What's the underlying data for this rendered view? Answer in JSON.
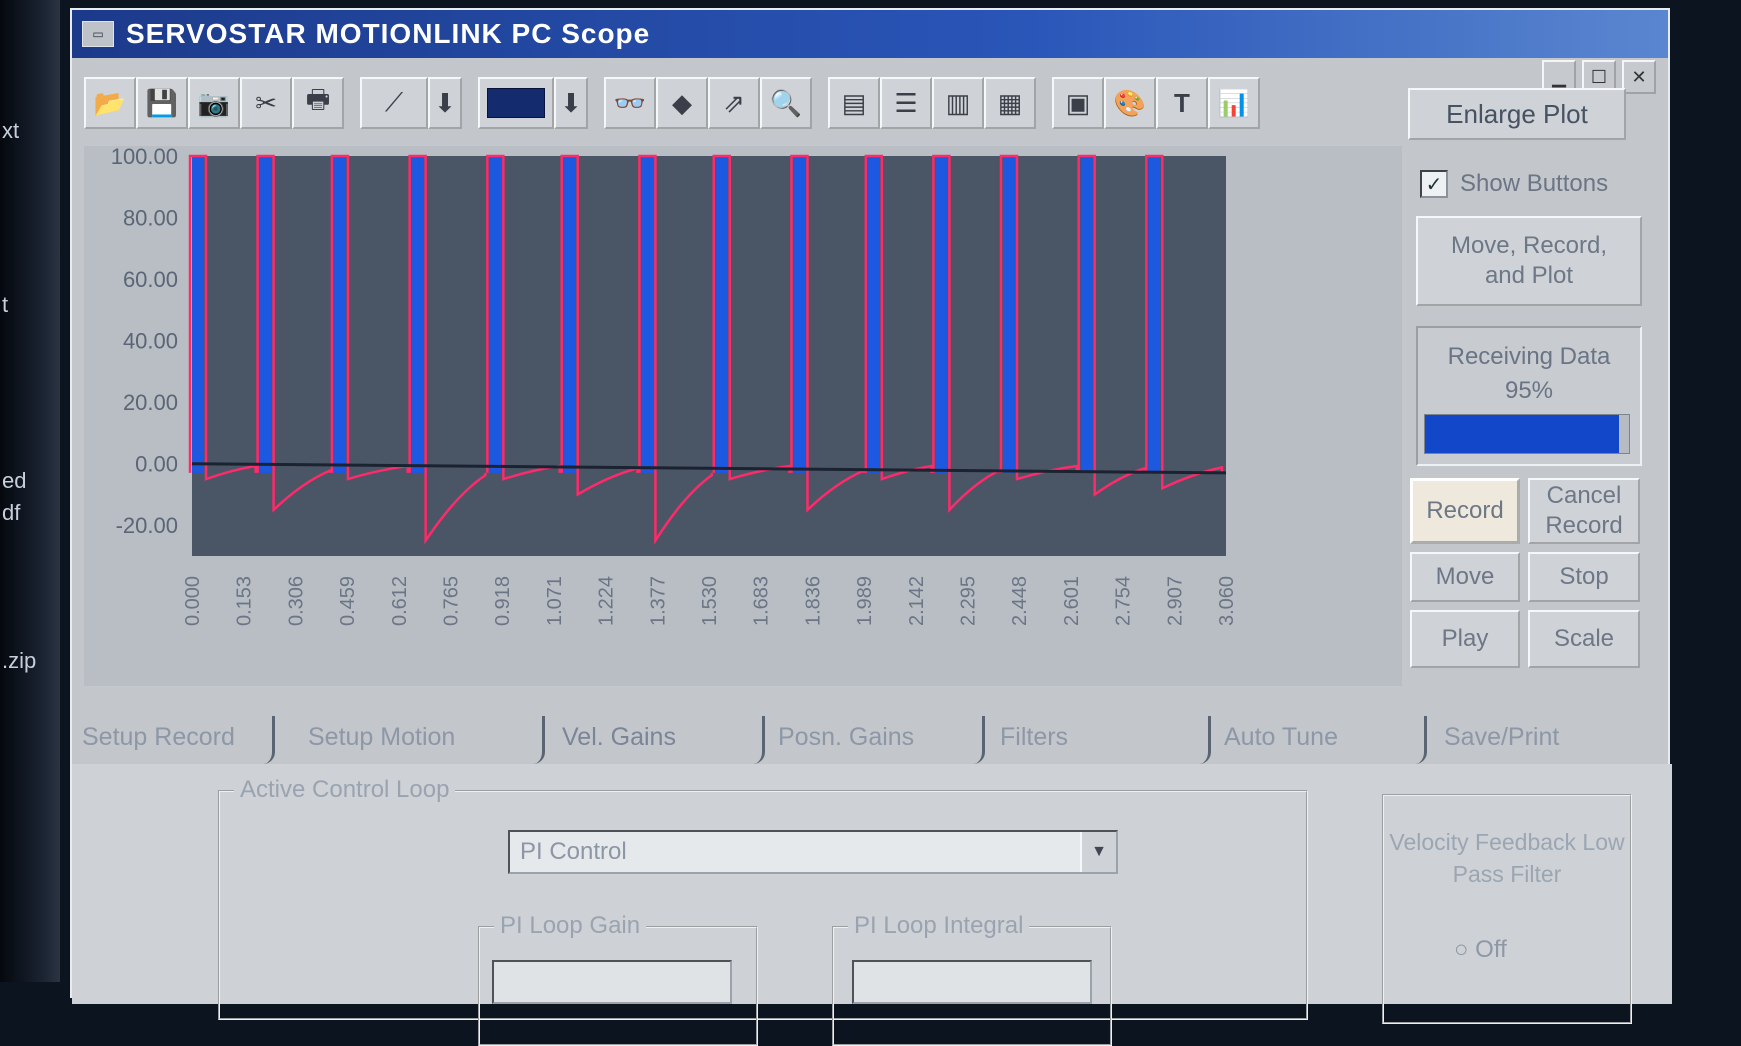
{
  "window": {
    "title": "SERVOSTAR MOTIONLINK PC Scope"
  },
  "left_fragments": [
    "xt",
    "t",
    "ed",
    "df",
    ".zip"
  ],
  "title_controls": [
    "minimize",
    "maximize",
    "close"
  ],
  "toolbar": {
    "enlarge_label": "Enlarge Plot",
    "icons": [
      "open-icon",
      "save-icon",
      "camera-icon",
      "cut-icon",
      "print-icon",
      "line-style-icon",
      "dropdown-arrow-icon",
      "color-swatch-icon",
      "dropdown-arrow-icon",
      "glasses-icon",
      "diamond-icon",
      "export-icon",
      "zoom-icon",
      "page-icon",
      "page-list-icon",
      "columns-icon",
      "rows-icon",
      "grid-abc-icon",
      "palette-icon",
      "text-icon",
      "axes-icon"
    ]
  },
  "side": {
    "show_buttons_label": "Show Buttons",
    "show_buttons_checked": true,
    "move_record_plot_label": "Move, Record, and Plot",
    "status_text": "Receiving Data",
    "progress_label": "95%",
    "progress_value": 95,
    "record_label": "Record",
    "cancel_record_label": "Cancel Record",
    "move_label": "Move",
    "stop_label": "Stop",
    "play_label": "Play",
    "scale_label": "Scale"
  },
  "chart_data": {
    "type": "line",
    "ylim": [
      -30,
      100
    ],
    "xlim": [
      0,
      3.06
    ],
    "yticks": [
      "100.00",
      "80.00",
      "60.00",
      "40.00",
      "20.00",
      "0.00",
      "-20.00"
    ],
    "yvals": [
      100,
      80,
      60,
      40,
      20,
      0,
      -20
    ],
    "xticks": [
      "0.000",
      "0.153",
      "0.306",
      "0.459",
      "0.612",
      "0.765",
      "0.918",
      "1.071",
      "1.224",
      "1.377",
      "1.530",
      "1.683",
      "1.836",
      "1.989",
      "2.142",
      "2.295",
      "2.448",
      "2.601",
      "2.754",
      "2.907",
      "3.060"
    ],
    "background": "#4a5566",
    "pulse_times": [
      0.0,
      0.2,
      0.42,
      0.65,
      0.88,
      1.1,
      1.33,
      1.55,
      1.78,
      2.0,
      2.2,
      2.4,
      2.63,
      2.83
    ],
    "undershoot": [
      -5,
      -15,
      -5,
      -25,
      -5,
      -10,
      -25,
      -5,
      -15,
      -5,
      -15,
      -5,
      -10,
      -8
    ],
    "series": [
      {
        "color": "#ff2a6a"
      },
      {
        "color": "#1c58e0"
      }
    ]
  },
  "tabs": [
    {
      "label": "Setup Record"
    },
    {
      "label": "Setup Motion"
    },
    {
      "label": "Vel. Gains"
    },
    {
      "label": "Posn. Gains"
    },
    {
      "label": "Filters"
    },
    {
      "label": "Auto Tune"
    },
    {
      "label": "Save/Print"
    }
  ],
  "tab_page": {
    "active_loop_legend": "Active Control Loop",
    "active_loop_value": "PI Control",
    "pi_gain_legend": "PI Loop Gain",
    "pi_gain_value": "",
    "pi_integral_legend": "PI Loop Integral",
    "pi_integral_value": "",
    "vel_feedback_label": "Velocity Feedback Low Pass Filter",
    "radio_label": "Off"
  }
}
